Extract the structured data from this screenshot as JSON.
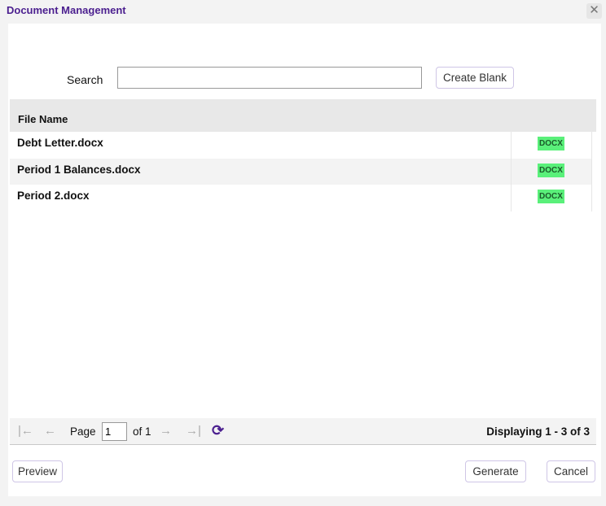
{
  "window": {
    "title": "Document Management",
    "close_icon": "close-icon"
  },
  "search": {
    "label": "Search",
    "value": "",
    "placeholder": ""
  },
  "create_blank_label": "Create Blank",
  "table": {
    "header": "File Name",
    "rows": [
      {
        "name": "Debt Letter.docx",
        "type": "DOCX"
      },
      {
        "name": "Period 1 Balances.docx",
        "type": "DOCX"
      },
      {
        "name": "Period 2.docx",
        "type": "DOCX"
      }
    ]
  },
  "pager": {
    "page_label": "Page",
    "page": "1",
    "of_label": "of 1",
    "display": "Displaying 1 - 3 of 3"
  },
  "buttons": {
    "preview": "Preview",
    "generate": "Generate",
    "cancel": "Cancel"
  },
  "colors": {
    "accent": "#4b1f8f",
    "badge": "#5af07a"
  }
}
